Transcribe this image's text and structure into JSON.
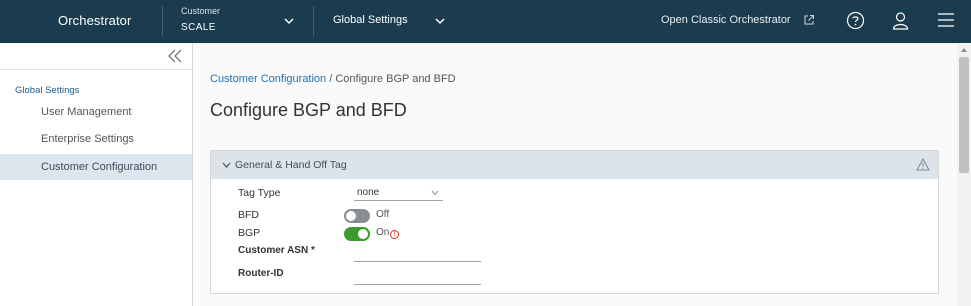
{
  "header": {
    "brand": "Orchestrator",
    "customer_label": "Customer",
    "customer_value": "SCALE",
    "section_title": "Global Settings",
    "classic_link": "Open Classic Orchestrator",
    "icons": [
      "external-link-icon",
      "help-icon",
      "user-icon",
      "menu-icon"
    ]
  },
  "sidebar": {
    "section": "Global Settings",
    "items": [
      {
        "label": "User Management",
        "active": false
      },
      {
        "label": "Enterprise Settings",
        "active": false
      },
      {
        "label": "Customer Configuration",
        "active": true
      }
    ]
  },
  "main": {
    "breadcrumb": {
      "link": "Customer Configuration",
      "separator": "/",
      "current": "Configure BGP and BFD"
    },
    "title": "Configure BGP and BFD",
    "panel": {
      "title": "General & Hand Off Tag",
      "fields": {
        "tag_type": {
          "label": "Tag Type",
          "value": "none"
        },
        "bfd": {
          "label": "BFD",
          "state": "Off"
        },
        "bgp": {
          "label": "BGP",
          "state": "On"
        },
        "customer_asn": {
          "label": "Customer ASN *",
          "value": ""
        },
        "router_id": {
          "label": "Router-ID",
          "value": ""
        }
      }
    }
  },
  "colors": {
    "header_bg": "#1a3c4e",
    "accent_link": "#1e72b8",
    "toggle_on": "#3d9a2f",
    "toggle_off": "#8a8f93",
    "active_nav": "#dde6ee",
    "panel_header": "#dce4ea"
  }
}
